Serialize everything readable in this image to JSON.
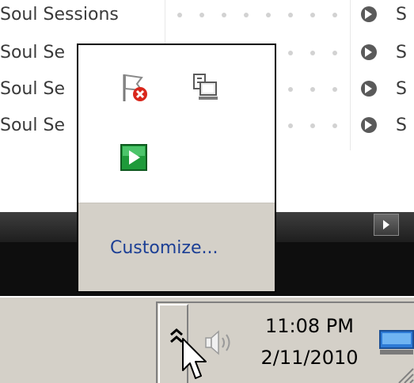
{
  "background_app": {
    "tracks": [
      {
        "title": "Soul Sessions"
      },
      {
        "title": "Soul Se"
      },
      {
        "title": "Soul Se"
      },
      {
        "title": "Soul Se"
      }
    ],
    "row_trailing_text": "S"
  },
  "tray_popup": {
    "icons": [
      {
        "name": "action-center-icon"
      },
      {
        "name": "network-icon"
      },
      {
        "name": "media-player-icon"
      }
    ],
    "customize_label": "Customize..."
  },
  "taskbar": {
    "clock": {
      "time": "11:08 PM",
      "date": "2/11/2010"
    }
  },
  "colors": {
    "link": "#1c3f95",
    "taskbar": "#d4d0c8",
    "error_badge": "#d9271c",
    "media_green": "#1e9a3a"
  }
}
